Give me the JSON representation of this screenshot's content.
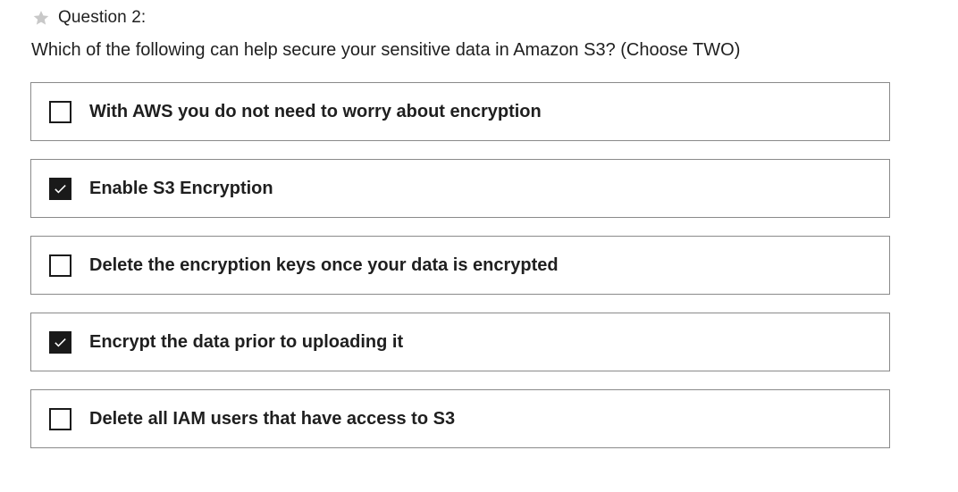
{
  "question": {
    "number_label": "Question 2:",
    "star_icon": "star-icon",
    "text": "Which of the following can help secure your sensitive data in Amazon S3? (Choose TWO)"
  },
  "colors": {
    "checkbox_checked": "#1a1a1a",
    "border": "#8a8a8a",
    "star": "#c8c8c8"
  },
  "options": [
    {
      "label": "With AWS you do not need to worry about encryption",
      "checked": false
    },
    {
      "label": "Enable S3 Encryption",
      "checked": true
    },
    {
      "label": "Delete the encryption keys once your data is encrypted",
      "checked": false
    },
    {
      "label": "Encrypt the data prior to uploading it",
      "checked": true
    },
    {
      "label": "Delete all IAM users that have access to S3",
      "checked": false
    }
  ]
}
